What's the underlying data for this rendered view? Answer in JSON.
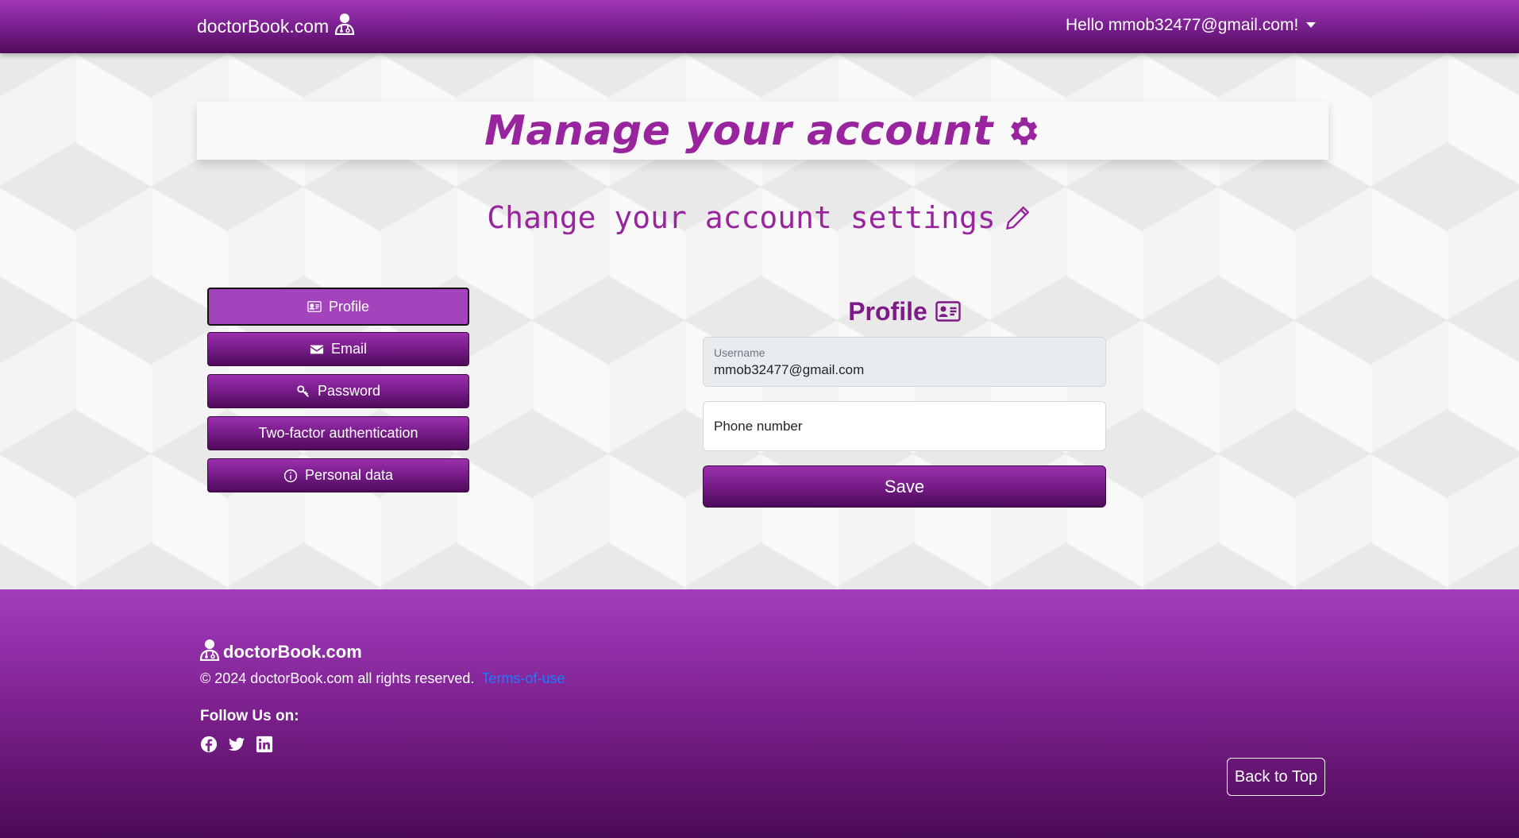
{
  "navbar": {
    "brand": "doctorBook.com",
    "user_greeting": "Hello mmob32477@gmail.com!"
  },
  "page": {
    "title": "Manage your account",
    "subtitle": "Change your account settings"
  },
  "sidebar": {
    "items": [
      {
        "label": "Profile",
        "icon": "id-card-icon",
        "active": true
      },
      {
        "label": "Email",
        "icon": "envelope-icon",
        "active": false
      },
      {
        "label": "Password",
        "icon": "key-icon",
        "active": false
      },
      {
        "label": "Two-factor authentication",
        "icon": "",
        "active": false
      },
      {
        "label": "Personal data",
        "icon": "info-icon",
        "active": false
      }
    ]
  },
  "form": {
    "heading": "Profile",
    "username_label": "Username",
    "username_value": "mmob32477@gmail.com",
    "phone_placeholder": "Phone number",
    "save_label": "Save"
  },
  "footer": {
    "brand": "doctorBook.com",
    "copyright": "© 2024 doctorBook.com all rights reserved.",
    "terms_link": "Terms-of-use",
    "follow_label": "Follow Us on:",
    "socials": [
      "facebook-icon",
      "twitter-icon",
      "linkedin-icon"
    ],
    "back_to_top": "Back to Top"
  },
  "colors": {
    "brand_purple": "#98259e",
    "dark_purple": "#4e0b59",
    "link_blue": "#1a7cff"
  }
}
